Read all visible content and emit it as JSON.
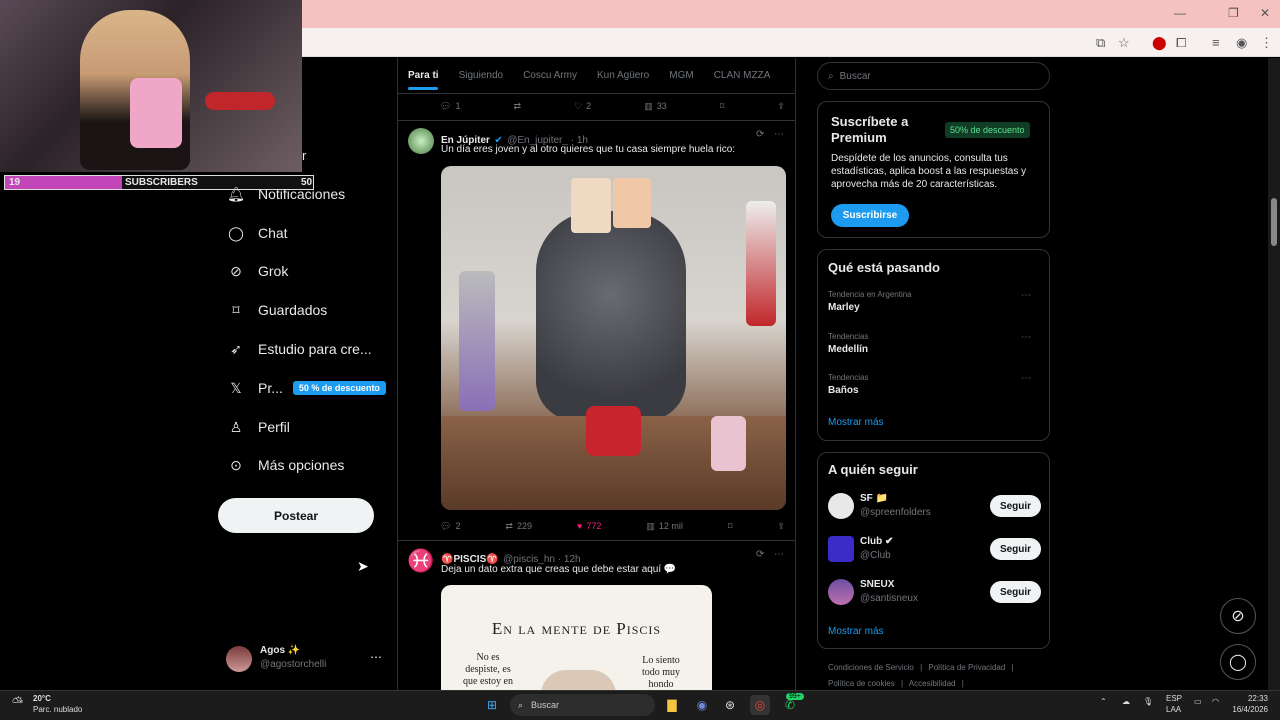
{
  "browser": {
    "window_controls": [
      "—",
      "❐",
      "✕"
    ]
  },
  "webcam": {
    "subscribers_current": "19",
    "subscribers_label": "SUBSCRIBERS",
    "subscribers_goal": "50",
    "progress_fraction": 0.38
  },
  "nav": {
    "partial_top": "r",
    "items": [
      {
        "label": "Notificaciones",
        "icon": "bell-icon"
      },
      {
        "label": "Chat",
        "icon": "chat-icon"
      },
      {
        "label": "Grok",
        "icon": "grok-icon"
      },
      {
        "label": "Guardados",
        "icon": "bookmark-icon"
      },
      {
        "label": "Estudio para cre...",
        "icon": "rocket-icon"
      },
      {
        "label": "Pr...",
        "icon": "x-logo-icon",
        "badge": "50 % de descuento"
      },
      {
        "label": "Perfil",
        "icon": "person-icon"
      },
      {
        "label": "Más opciones",
        "icon": "more-circle-icon"
      }
    ],
    "post_label": "Postear",
    "account": {
      "name": "Agos ✨",
      "handle": "@agostorchelli"
    }
  },
  "feed": {
    "tabs": [
      "Para ti",
      "Siguiendo",
      "Coscu Army",
      "Kun Agüero",
      "MGM",
      "CLAN MZZA"
    ],
    "prev_actions": {
      "replies": "1",
      "reposts": "",
      "likes": "2",
      "views": "33"
    },
    "tweet1": {
      "name": "En Júpiter",
      "handle": "@En_jupiter_ · 1h",
      "text": "Un día eres joven y al otro quieres que tu casa siempre huela rico:",
      "replies": "2",
      "reposts": "229",
      "likes": "772",
      "views": "12 mil"
    },
    "tweet2": {
      "name": "♈PISCIS♈",
      "handle": "@piscis_hn · 12h",
      "text": "Deja un dato extra que creas que debe estar aquí 💬",
      "image_title": "En la mente de Piscis",
      "image_left": "No es despiste, es que estoy en",
      "image_right": "Lo siento todo muy hondo"
    }
  },
  "right": {
    "search_placeholder": "Buscar",
    "premium": {
      "title": "Suscríbete a Premium",
      "badge": "50% de descuento",
      "desc": "Despídete de los anuncios, consulta tus estadísticas, aplica boost a las respuestas y aprovecha más de 20 características.",
      "button": "Suscribirse"
    },
    "trending": {
      "title": "Qué está pasando",
      "items": [
        {
          "category": "Tendencia en Argentina",
          "name": "Marley"
        },
        {
          "category": "Tendencias",
          "name": "Medellín"
        },
        {
          "category": "Tendencias",
          "name": "Baños"
        }
      ],
      "show_more": "Mostrar más"
    },
    "follow": {
      "title": "A quién seguir",
      "items": [
        {
          "name": "SF 📁",
          "handle": "@spreenfolders",
          "button": "Seguir"
        },
        {
          "name": "Club ✔",
          "handle": "@Club",
          "button": "Seguir"
        },
        {
          "name": "SNEUX",
          "handle": "@santisneux",
          "button": "Seguir"
        }
      ],
      "show_more": "Mostrar más"
    },
    "footer": [
      "Condiciones de Servicio",
      "Política de Privacidad",
      "Política de cookies",
      "Accesibilidad"
    ]
  },
  "taskbar": {
    "weather_temp": "20°C",
    "weather_desc": "Parc. nublado",
    "search": "Buscar",
    "lang": "ESP",
    "lang2": "LAA",
    "time": "22:33",
    "date": "16/4/2026",
    "badge_count": "99+"
  }
}
